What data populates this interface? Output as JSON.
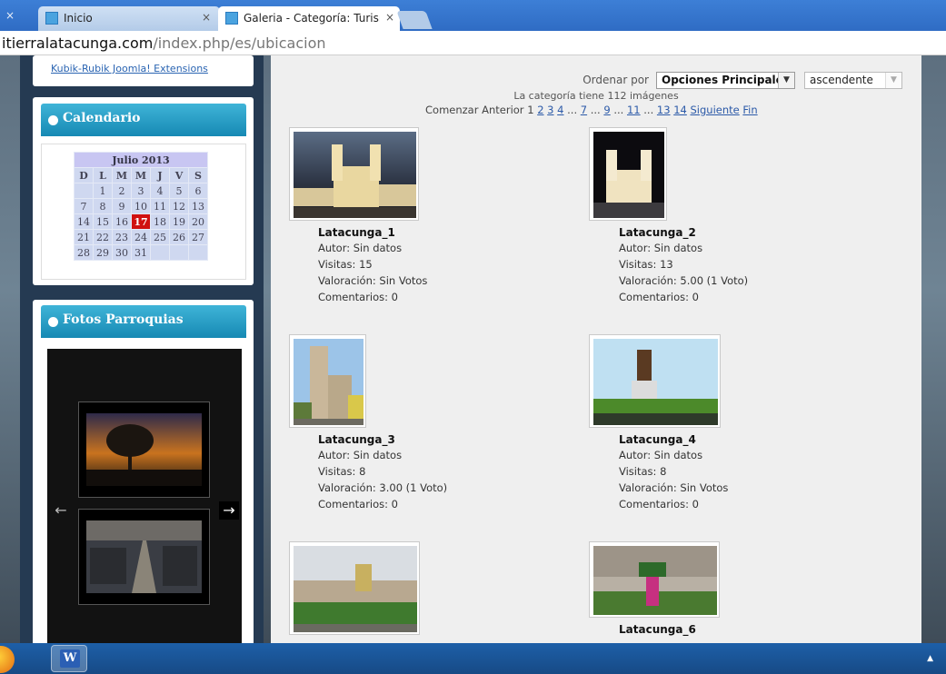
{
  "browser": {
    "tabs": [
      {
        "label": "Inicio"
      },
      {
        "label": "Galeria - Categoría: Turisn"
      }
    ],
    "close_glyph": "×",
    "url_domain": "itierralatacunga.com",
    "url_path": "/index.php/es/ubicacion"
  },
  "sidebar": {
    "ext_link": "Kubik-Rubik Joomla! Extensions",
    "calendar": {
      "title": "Calendario",
      "month": "Julio 2013",
      "days": [
        "D",
        "L",
        "M",
        "M",
        "J",
        "V",
        "S"
      ],
      "weeks": [
        [
          "",
          "1",
          "2",
          "3",
          "4",
          "5",
          "6"
        ],
        [
          "7",
          "8",
          "9",
          "10",
          "11",
          "12",
          "13"
        ],
        [
          "14",
          "15",
          "16",
          "17",
          "18",
          "19",
          "20"
        ],
        [
          "21",
          "22",
          "23",
          "24",
          "25",
          "26",
          "27"
        ],
        [
          "28",
          "29",
          "30",
          "31",
          "",
          "",
          ""
        ]
      ],
      "today": "17"
    },
    "photos": {
      "title": "Fotos Parroquias",
      "prev_arrow": "←",
      "next_arrow": "→"
    }
  },
  "main": {
    "order_label": "Ordenar por",
    "order_value": "Opciones Principales",
    "direction_value": "ascendente",
    "count_text": "La categoría tiene 112 imágenes",
    "pagination": {
      "start": "Comenzar",
      "prev": "Anterior",
      "current": "1",
      "pages": [
        "2",
        "3",
        "4"
      ],
      "ell": "...",
      "p7": "7",
      "p9": "9",
      "p11": "11",
      "p13": "13",
      "p14": "14",
      "next": "Siguiente",
      "end": "Fin"
    },
    "images": [
      {
        "title": "Latacunga_1",
        "autor": "Autor: Sin datos",
        "visitas": "Visitas: 15",
        "valoracion": "Valoración: Sin Votos",
        "comentarios": "Comentarios: 0"
      },
      {
        "title": "Latacunga_2",
        "autor": "Autor: Sin datos",
        "visitas": "Visitas: 13",
        "valoracion": "Valoración: 5.00 (1 Voto)",
        "comentarios": "Comentarios: 0"
      },
      {
        "title": "Latacunga_3",
        "autor": "Autor: Sin datos",
        "visitas": "Visitas: 8",
        "valoracion": "Valoración: 3.00 (1 Voto)",
        "comentarios": "Comentarios: 0"
      },
      {
        "title": "Latacunga_4",
        "autor": "Autor: Sin datos",
        "visitas": "Visitas: 8",
        "valoracion": "Valoración: Sin Votos",
        "comentarios": "Comentarios: 0"
      },
      {
        "title": "Latacunga_6"
      }
    ]
  },
  "taskbar": {
    "word_glyph": "W",
    "tray_glyph": "▲"
  },
  "colors": {
    "accent": "#1689b4",
    "today": "#d01010",
    "link": "#2c5aa8"
  }
}
